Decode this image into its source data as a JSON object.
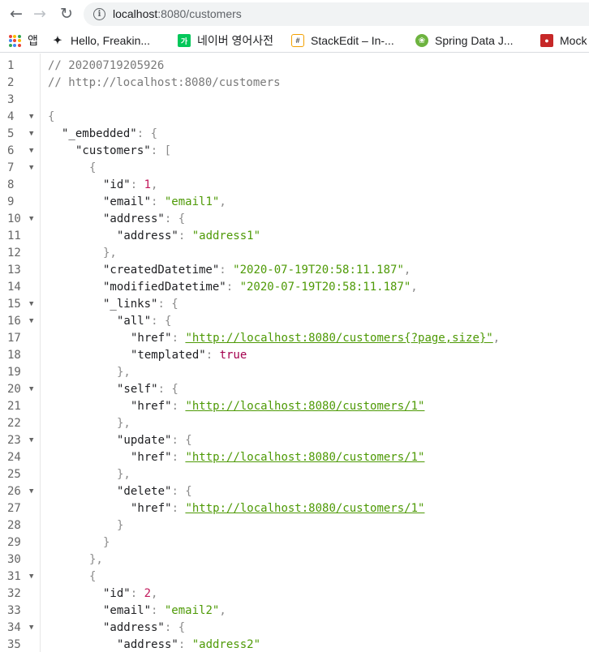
{
  "browser": {
    "url_host": "localhost",
    "url_rest": ":8080/customers",
    "bookmarks": [
      {
        "label": "앱",
        "icon": "apps-grid-icon"
      },
      {
        "label": "Hello, Freakin...",
        "icon": "bee-icon"
      },
      {
        "label": "네이버 영어사전",
        "icon": "naver-dictionary-icon"
      },
      {
        "label": "StackEdit – In-...",
        "icon": "stackedit-icon"
      },
      {
        "label": "Spring Data J...",
        "icon": "spring-leaf-icon"
      },
      {
        "label": "Mock",
        "icon": "mock-icon"
      }
    ]
  },
  "code_lines": [
    {
      "n": "1",
      "fold": false,
      "indent": 0,
      "tokens": [
        {
          "t": "// 20200719205926",
          "c": "comment"
        }
      ]
    },
    {
      "n": "2",
      "fold": false,
      "indent": 0,
      "tokens": [
        {
          "t": "// http://localhost:8080/customers",
          "c": "comment"
        }
      ]
    },
    {
      "n": "3",
      "fold": false,
      "indent": 0,
      "tokens": []
    },
    {
      "n": "4",
      "fold": true,
      "indent": 0,
      "tokens": [
        {
          "t": "{",
          "c": "brace"
        }
      ]
    },
    {
      "n": "5",
      "fold": true,
      "indent": 1,
      "tokens": [
        {
          "t": "\"_embedded\"",
          "c": "key"
        },
        {
          "t": ": {",
          "c": "punct"
        }
      ]
    },
    {
      "n": "6",
      "fold": true,
      "indent": 2,
      "tokens": [
        {
          "t": "\"customers\"",
          "c": "key"
        },
        {
          "t": ": [",
          "c": "punct"
        }
      ]
    },
    {
      "n": "7",
      "fold": true,
      "indent": 3,
      "tokens": [
        {
          "t": "{",
          "c": "brace"
        }
      ]
    },
    {
      "n": "8",
      "fold": false,
      "indent": 4,
      "tokens": [
        {
          "t": "\"id\"",
          "c": "key"
        },
        {
          "t": ": ",
          "c": "punct"
        },
        {
          "t": "1",
          "c": "num"
        },
        {
          "t": ",",
          "c": "punct"
        }
      ]
    },
    {
      "n": "9",
      "fold": false,
      "indent": 4,
      "tokens": [
        {
          "t": "\"email\"",
          "c": "key"
        },
        {
          "t": ": ",
          "c": "punct"
        },
        {
          "t": "\"email1\"",
          "c": "str"
        },
        {
          "t": ",",
          "c": "punct"
        }
      ]
    },
    {
      "n": "10",
      "fold": true,
      "indent": 4,
      "tokens": [
        {
          "t": "\"address\"",
          "c": "key"
        },
        {
          "t": ": {",
          "c": "punct"
        }
      ]
    },
    {
      "n": "11",
      "fold": false,
      "indent": 5,
      "tokens": [
        {
          "t": "\"address\"",
          "c": "key"
        },
        {
          "t": ": ",
          "c": "punct"
        },
        {
          "t": "\"address1\"",
          "c": "str"
        }
      ]
    },
    {
      "n": "12",
      "fold": false,
      "indent": 4,
      "tokens": [
        {
          "t": "},",
          "c": "brace"
        }
      ]
    },
    {
      "n": "13",
      "fold": false,
      "indent": 4,
      "tokens": [
        {
          "t": "\"createdDatetime\"",
          "c": "key"
        },
        {
          "t": ": ",
          "c": "punct"
        },
        {
          "t": "\"2020-07-19T20:58:11.187\"",
          "c": "str"
        },
        {
          "t": ",",
          "c": "punct"
        }
      ]
    },
    {
      "n": "14",
      "fold": false,
      "indent": 4,
      "tokens": [
        {
          "t": "\"modifiedDatetime\"",
          "c": "key"
        },
        {
          "t": ": ",
          "c": "punct"
        },
        {
          "t": "\"2020-07-19T20:58:11.187\"",
          "c": "str"
        },
        {
          "t": ",",
          "c": "punct"
        }
      ]
    },
    {
      "n": "15",
      "fold": true,
      "indent": 4,
      "tokens": [
        {
          "t": "\"_links\"",
          "c": "key"
        },
        {
          "t": ": {",
          "c": "punct"
        }
      ]
    },
    {
      "n": "16",
      "fold": true,
      "indent": 5,
      "tokens": [
        {
          "t": "\"all\"",
          "c": "key"
        },
        {
          "t": ": {",
          "c": "punct"
        }
      ]
    },
    {
      "n": "17",
      "fold": false,
      "indent": 6,
      "tokens": [
        {
          "t": "\"href\"",
          "c": "key"
        },
        {
          "t": ": ",
          "c": "punct"
        },
        {
          "t": "\"http://localhost:8080/customers{?page,size}\"",
          "c": "link"
        },
        {
          "t": ",",
          "c": "punct"
        }
      ]
    },
    {
      "n": "18",
      "fold": false,
      "indent": 6,
      "tokens": [
        {
          "t": "\"templated\"",
          "c": "key"
        },
        {
          "t": ": ",
          "c": "punct"
        },
        {
          "t": "true",
          "c": "bool"
        }
      ]
    },
    {
      "n": "19",
      "fold": false,
      "indent": 5,
      "tokens": [
        {
          "t": "},",
          "c": "brace"
        }
      ]
    },
    {
      "n": "20",
      "fold": true,
      "indent": 5,
      "tokens": [
        {
          "t": "\"self\"",
          "c": "key"
        },
        {
          "t": ": {",
          "c": "punct"
        }
      ]
    },
    {
      "n": "21",
      "fold": false,
      "indent": 6,
      "tokens": [
        {
          "t": "\"href\"",
          "c": "key"
        },
        {
          "t": ": ",
          "c": "punct"
        },
        {
          "t": "\"http://localhost:8080/customers/1\"",
          "c": "link"
        }
      ]
    },
    {
      "n": "22",
      "fold": false,
      "indent": 5,
      "tokens": [
        {
          "t": "},",
          "c": "brace"
        }
      ]
    },
    {
      "n": "23",
      "fold": true,
      "indent": 5,
      "tokens": [
        {
          "t": "\"update\"",
          "c": "key"
        },
        {
          "t": ": {",
          "c": "punct"
        }
      ]
    },
    {
      "n": "24",
      "fold": false,
      "indent": 6,
      "tokens": [
        {
          "t": "\"href\"",
          "c": "key"
        },
        {
          "t": ": ",
          "c": "punct"
        },
        {
          "t": "\"http://localhost:8080/customers/1\"",
          "c": "link"
        }
      ]
    },
    {
      "n": "25",
      "fold": false,
      "indent": 5,
      "tokens": [
        {
          "t": "},",
          "c": "brace"
        }
      ]
    },
    {
      "n": "26",
      "fold": true,
      "indent": 5,
      "tokens": [
        {
          "t": "\"delete\"",
          "c": "key"
        },
        {
          "t": ": {",
          "c": "punct"
        }
      ]
    },
    {
      "n": "27",
      "fold": false,
      "indent": 6,
      "tokens": [
        {
          "t": "\"href\"",
          "c": "key"
        },
        {
          "t": ": ",
          "c": "punct"
        },
        {
          "t": "\"http://localhost:8080/customers/1\"",
          "c": "link"
        }
      ]
    },
    {
      "n": "28",
      "fold": false,
      "indent": 5,
      "tokens": [
        {
          "t": "}",
          "c": "brace"
        }
      ]
    },
    {
      "n": "29",
      "fold": false,
      "indent": 4,
      "tokens": [
        {
          "t": "}",
          "c": "brace"
        }
      ]
    },
    {
      "n": "30",
      "fold": false,
      "indent": 3,
      "tokens": [
        {
          "t": "},",
          "c": "brace"
        }
      ]
    },
    {
      "n": "31",
      "fold": true,
      "indent": 3,
      "tokens": [
        {
          "t": "{",
          "c": "brace"
        }
      ]
    },
    {
      "n": "32",
      "fold": false,
      "indent": 4,
      "tokens": [
        {
          "t": "\"id\"",
          "c": "key"
        },
        {
          "t": ": ",
          "c": "punct"
        },
        {
          "t": "2",
          "c": "num"
        },
        {
          "t": ",",
          "c": "punct"
        }
      ]
    },
    {
      "n": "33",
      "fold": false,
      "indent": 4,
      "tokens": [
        {
          "t": "\"email\"",
          "c": "key"
        },
        {
          "t": ": ",
          "c": "punct"
        },
        {
          "t": "\"email2\"",
          "c": "str"
        },
        {
          "t": ",",
          "c": "punct"
        }
      ]
    },
    {
      "n": "34",
      "fold": true,
      "indent": 4,
      "tokens": [
        {
          "t": "\"address\"",
          "c": "key"
        },
        {
          "t": ": {",
          "c": "punct"
        }
      ]
    },
    {
      "n": "35",
      "fold": false,
      "indent": 5,
      "tokens": [
        {
          "t": "\"address\"",
          "c": "key"
        },
        {
          "t": ": ",
          "c": "punct"
        },
        {
          "t": "\"address2\"",
          "c": "str"
        }
      ]
    }
  ]
}
